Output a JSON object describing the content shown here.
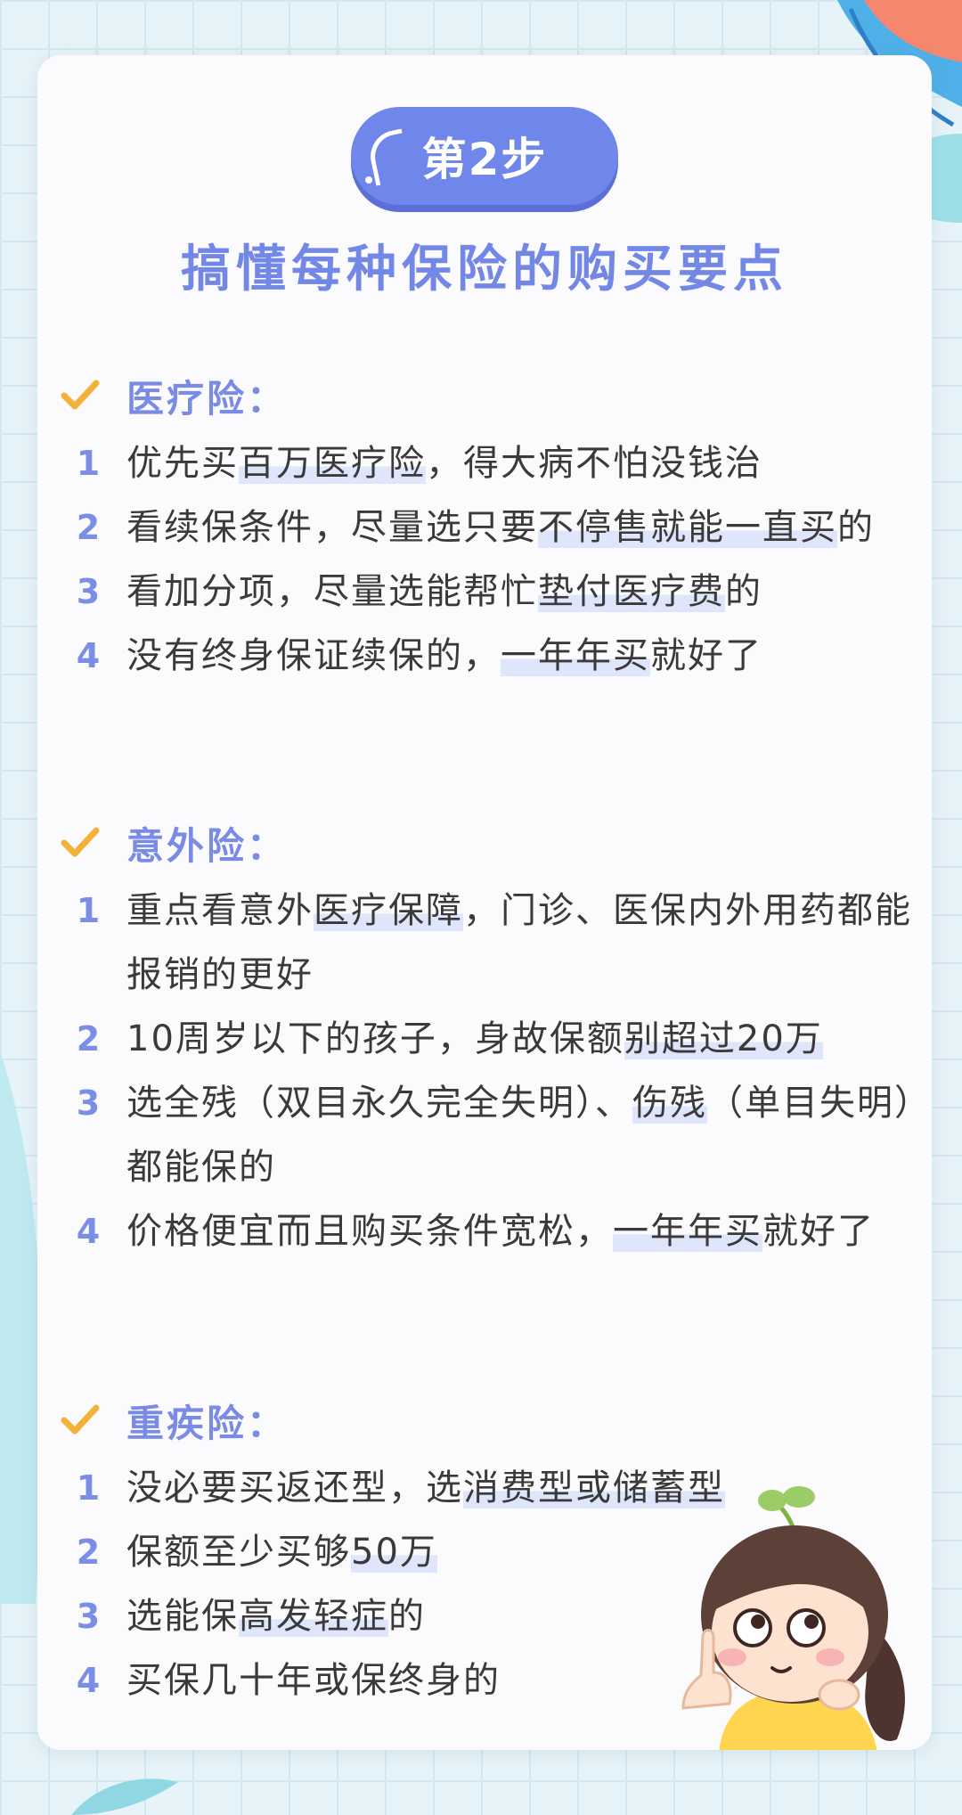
{
  "step_badge": "第2步",
  "subtitle": "搞懂每种保险的购买要点",
  "colors": {
    "accent": "#7287e6",
    "check": "#f2b23a",
    "highlight": "#dfe5fb",
    "text": "#3a3a3a"
  },
  "icons": {
    "check": "check-icon",
    "pill_decoration": "quote-arc-icon"
  },
  "sections": [
    {
      "title": "医疗险：",
      "items": [
        {
          "num": "1",
          "before": "优先买",
          "hl": "百万医疗险",
          "after": "，得大病不怕没钱治"
        },
        {
          "num": "2",
          "before": "看续保条件，尽量选只要",
          "hl": "不停售就能一直买",
          "after": "的"
        },
        {
          "num": "3",
          "before": "看加分项，尽量选能帮忙",
          "hl": "垫付医疗费",
          "after": "的"
        },
        {
          "num": "4",
          "before": "没有终身保证续保的，",
          "hl": "一年年买",
          "after": "就好了"
        }
      ]
    },
    {
      "title": "意外险：",
      "items": [
        {
          "num": "1",
          "before": "重点看意外",
          "hl": "医疗保障",
          "after": "，门诊、医保内外用药都能报销的更好"
        },
        {
          "num": "2",
          "before": "10周岁以下的孩子，身故保额",
          "hl": "别超过20万",
          "after": ""
        },
        {
          "num": "3",
          "before": "选全残（双目永久完全失明）、",
          "hl": "伤残",
          "after": "（单目失明）都能保的"
        },
        {
          "num": "4",
          "before": "价格便宜而且购买条件宽松，",
          "hl": "一年年买",
          "after": "就好了"
        }
      ]
    },
    {
      "title": "重疾险：",
      "items": [
        {
          "num": "1",
          "before": "没必要买返还型，选",
          "hl": "消费型或储蓄型",
          "after": ""
        },
        {
          "num": "2",
          "before": "保额至少买够",
          "hl": "50万",
          "after": ""
        },
        {
          "num": "3",
          "before": "选能保",
          "hl": "高发轻症",
          "after": "的"
        },
        {
          "num": "4",
          "before": "买保几十年或保终身的",
          "hl": "",
          "after": ""
        }
      ]
    }
  ]
}
